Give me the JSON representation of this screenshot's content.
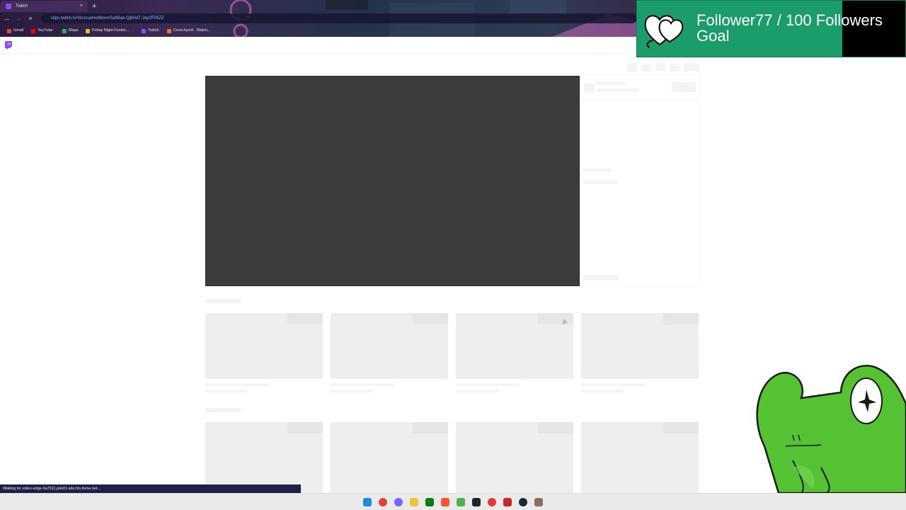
{
  "browser": {
    "tab_title": "Twitch",
    "new_tab_symbol": "+",
    "close_symbol": "×",
    "back_symbol": "←",
    "forward_symbol": "→",
    "reload_symbol": "×",
    "url": "clips.twitch.tv/ViscousHotWormSaltBae-Qj8Hd7-1by2FP6ZZ",
    "bookmarks": [
      {
        "label": "Gmail",
        "color": "#ea4335"
      },
      {
        "label": "YouTube",
        "color": "#ff0000"
      },
      {
        "label": "Maps",
        "color": "#34a853"
      },
      {
        "label": "Friday Night Funkin...",
        "color": "#f7b32b"
      },
      {
        "label": "Twitch",
        "color": "#9146ff"
      },
      {
        "label": "Crunchyroll - Watch...",
        "color": "#f47521"
      }
    ]
  },
  "page": {
    "logo_icon": "twitch-icon",
    "status_text": "Waiting for video-edge-6a7511.pdx01.abs.hls.ttvnw.net..."
  },
  "overlay": {
    "goal_line1": "Follower77 / 100 Followers",
    "goal_line2": "Goal",
    "goal_color": "#1b9c6b",
    "heart_icon": "heart-icon",
    "mascot_icon": "frog-icon",
    "mascot_color": "#55c234"
  },
  "taskbar": {
    "icons": [
      {
        "name": "windows-start-icon",
        "color": "#1e88e5"
      },
      {
        "name": "chrome-icon",
        "color": "#db4437"
      },
      {
        "name": "browser-icon",
        "color": "#7b61ff"
      },
      {
        "name": "file-explorer-icon",
        "color": "#f6c042"
      },
      {
        "name": "xbox-icon",
        "color": "#107c10"
      },
      {
        "name": "brave-icon",
        "color": "#fb542b"
      },
      {
        "name": "minecraft-icon",
        "color": "#4caf50"
      },
      {
        "name": "terminal-icon",
        "color": "#222222"
      },
      {
        "name": "app-icon",
        "color": "#e53935"
      },
      {
        "name": "valorant-icon",
        "color": "#c62828"
      },
      {
        "name": "steam-icon",
        "color": "#1b2838"
      },
      {
        "name": "game-icon",
        "color": "#8d6e63"
      }
    ]
  }
}
